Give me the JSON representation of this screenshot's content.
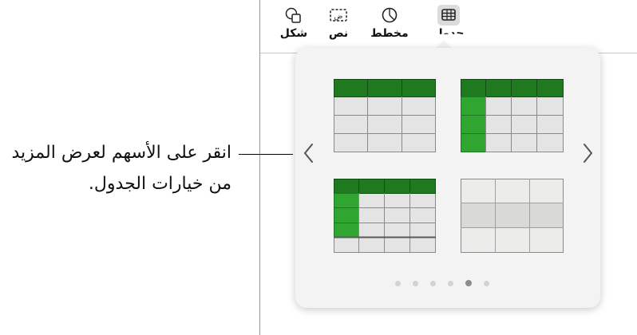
{
  "toolbar": {
    "items": [
      {
        "label": "جدول",
        "icon": "table-icon",
        "active": true
      },
      {
        "label": "مخطط",
        "icon": "chart-icon"
      },
      {
        "label": "نص",
        "icon": "text-box-icon"
      },
      {
        "label": "شكل",
        "icon": "shape-icon"
      }
    ]
  },
  "popover": {
    "styles": [
      {
        "name": "table-style-header-row"
      },
      {
        "name": "table-style-header-row-and-column"
      },
      {
        "name": "table-style-header-column-footer"
      },
      {
        "name": "table-style-plain-gray"
      }
    ],
    "page_dots": 6,
    "active_page": 5
  },
  "callout": {
    "text": "انقر على الأسهم لعرض المزيد من خيارات الجدول."
  },
  "colors": {
    "green_dark": "#1f7a1f",
    "green_bright": "#2fa62f",
    "cell_gray": "#e4e4e4",
    "grid_line": "#8a8a8a",
    "plain_mid": "#d9d9d5"
  }
}
